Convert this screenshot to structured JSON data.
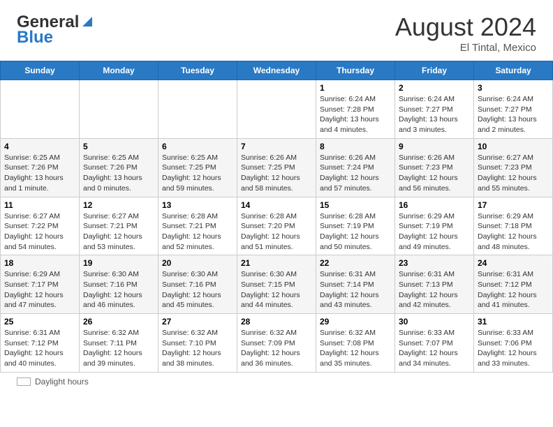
{
  "header": {
    "logo_line1": "General",
    "logo_line2": "Blue",
    "month_year": "August 2024",
    "location": "El Tintal, Mexico"
  },
  "days_of_week": [
    "Sunday",
    "Monday",
    "Tuesday",
    "Wednesday",
    "Thursday",
    "Friday",
    "Saturday"
  ],
  "weeks": [
    [
      {
        "num": "",
        "info": ""
      },
      {
        "num": "",
        "info": ""
      },
      {
        "num": "",
        "info": ""
      },
      {
        "num": "",
        "info": ""
      },
      {
        "num": "1",
        "info": "Sunrise: 6:24 AM\nSunset: 7:28 PM\nDaylight: 13 hours and 4 minutes."
      },
      {
        "num": "2",
        "info": "Sunrise: 6:24 AM\nSunset: 7:27 PM\nDaylight: 13 hours and 3 minutes."
      },
      {
        "num": "3",
        "info": "Sunrise: 6:24 AM\nSunset: 7:27 PM\nDaylight: 13 hours and 2 minutes."
      }
    ],
    [
      {
        "num": "4",
        "info": "Sunrise: 6:25 AM\nSunset: 7:26 PM\nDaylight: 13 hours and 1 minute."
      },
      {
        "num": "5",
        "info": "Sunrise: 6:25 AM\nSunset: 7:26 PM\nDaylight: 13 hours and 0 minutes."
      },
      {
        "num": "6",
        "info": "Sunrise: 6:25 AM\nSunset: 7:25 PM\nDaylight: 12 hours and 59 minutes."
      },
      {
        "num": "7",
        "info": "Sunrise: 6:26 AM\nSunset: 7:25 PM\nDaylight: 12 hours and 58 minutes."
      },
      {
        "num": "8",
        "info": "Sunrise: 6:26 AM\nSunset: 7:24 PM\nDaylight: 12 hours and 57 minutes."
      },
      {
        "num": "9",
        "info": "Sunrise: 6:26 AM\nSunset: 7:23 PM\nDaylight: 12 hours and 56 minutes."
      },
      {
        "num": "10",
        "info": "Sunrise: 6:27 AM\nSunset: 7:23 PM\nDaylight: 12 hours and 55 minutes."
      }
    ],
    [
      {
        "num": "11",
        "info": "Sunrise: 6:27 AM\nSunset: 7:22 PM\nDaylight: 12 hours and 54 minutes."
      },
      {
        "num": "12",
        "info": "Sunrise: 6:27 AM\nSunset: 7:21 PM\nDaylight: 12 hours and 53 minutes."
      },
      {
        "num": "13",
        "info": "Sunrise: 6:28 AM\nSunset: 7:21 PM\nDaylight: 12 hours and 52 minutes."
      },
      {
        "num": "14",
        "info": "Sunrise: 6:28 AM\nSunset: 7:20 PM\nDaylight: 12 hours and 51 minutes."
      },
      {
        "num": "15",
        "info": "Sunrise: 6:28 AM\nSunset: 7:19 PM\nDaylight: 12 hours and 50 minutes."
      },
      {
        "num": "16",
        "info": "Sunrise: 6:29 AM\nSunset: 7:19 PM\nDaylight: 12 hours and 49 minutes."
      },
      {
        "num": "17",
        "info": "Sunrise: 6:29 AM\nSunset: 7:18 PM\nDaylight: 12 hours and 48 minutes."
      }
    ],
    [
      {
        "num": "18",
        "info": "Sunrise: 6:29 AM\nSunset: 7:17 PM\nDaylight: 12 hours and 47 minutes."
      },
      {
        "num": "19",
        "info": "Sunrise: 6:30 AM\nSunset: 7:16 PM\nDaylight: 12 hours and 46 minutes."
      },
      {
        "num": "20",
        "info": "Sunrise: 6:30 AM\nSunset: 7:16 PM\nDaylight: 12 hours and 45 minutes."
      },
      {
        "num": "21",
        "info": "Sunrise: 6:30 AM\nSunset: 7:15 PM\nDaylight: 12 hours and 44 minutes."
      },
      {
        "num": "22",
        "info": "Sunrise: 6:31 AM\nSunset: 7:14 PM\nDaylight: 12 hours and 43 minutes."
      },
      {
        "num": "23",
        "info": "Sunrise: 6:31 AM\nSunset: 7:13 PM\nDaylight: 12 hours and 42 minutes."
      },
      {
        "num": "24",
        "info": "Sunrise: 6:31 AM\nSunset: 7:12 PM\nDaylight: 12 hours and 41 minutes."
      }
    ],
    [
      {
        "num": "25",
        "info": "Sunrise: 6:31 AM\nSunset: 7:12 PM\nDaylight: 12 hours and 40 minutes."
      },
      {
        "num": "26",
        "info": "Sunrise: 6:32 AM\nSunset: 7:11 PM\nDaylight: 12 hours and 39 minutes."
      },
      {
        "num": "27",
        "info": "Sunrise: 6:32 AM\nSunset: 7:10 PM\nDaylight: 12 hours and 38 minutes."
      },
      {
        "num": "28",
        "info": "Sunrise: 6:32 AM\nSunset: 7:09 PM\nDaylight: 12 hours and 36 minutes."
      },
      {
        "num": "29",
        "info": "Sunrise: 6:32 AM\nSunset: 7:08 PM\nDaylight: 12 hours and 35 minutes."
      },
      {
        "num": "30",
        "info": "Sunrise: 6:33 AM\nSunset: 7:07 PM\nDaylight: 12 hours and 34 minutes."
      },
      {
        "num": "31",
        "info": "Sunrise: 6:33 AM\nSunset: 7:06 PM\nDaylight: 12 hours and 33 minutes."
      }
    ]
  ],
  "footer": {
    "daylight_label": "Daylight hours"
  }
}
